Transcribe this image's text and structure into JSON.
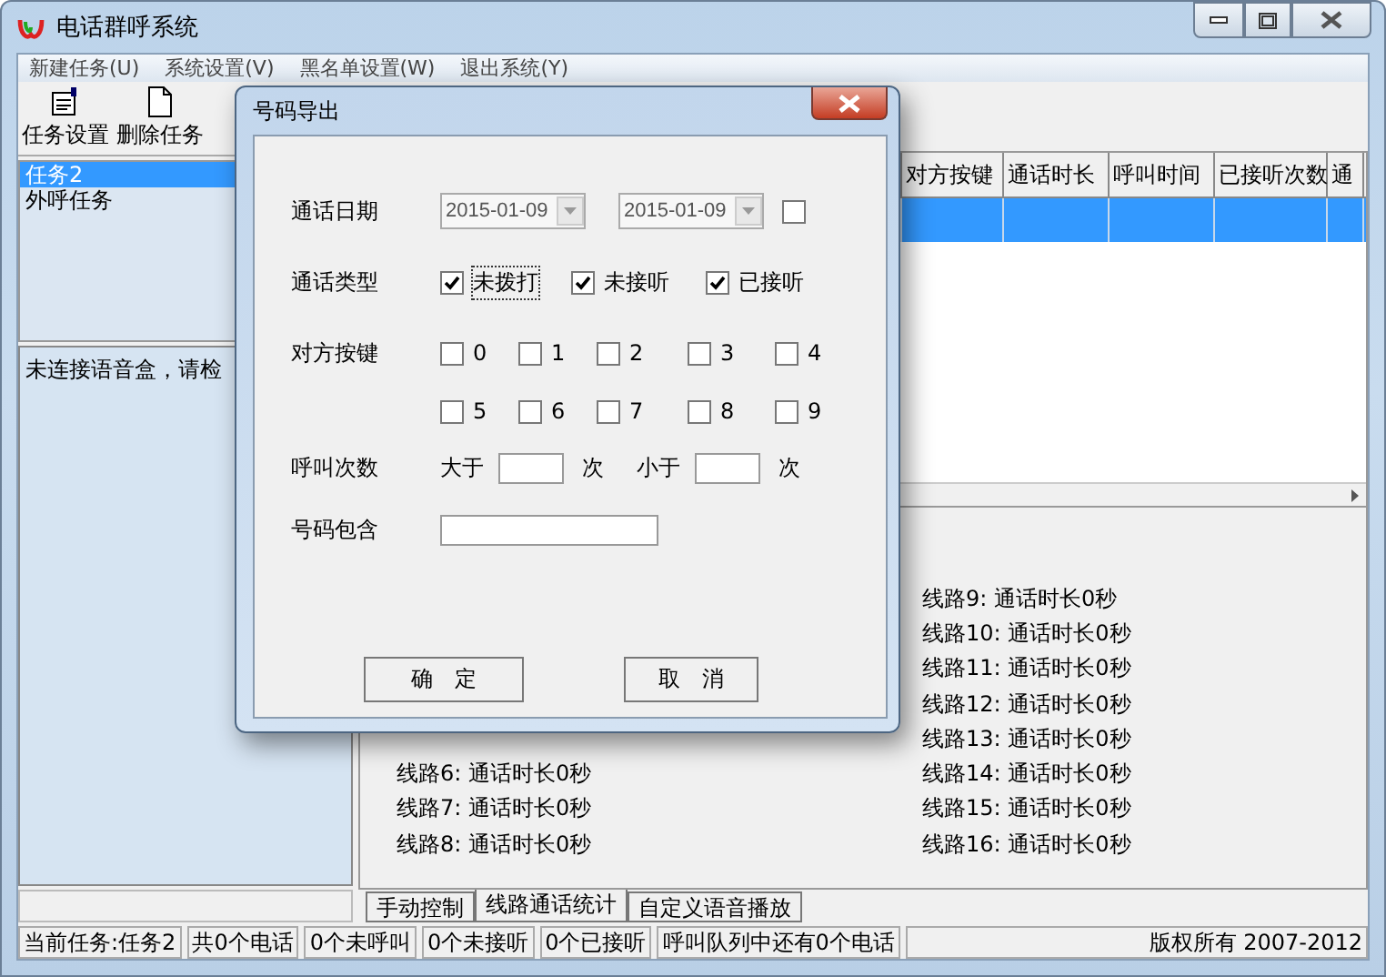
{
  "window": {
    "title": "电话群呼系统"
  },
  "menu": [
    "新建任务(U)",
    "系统设置(V)",
    "黑名单设置(W)",
    "退出系统(Y)"
  ],
  "toolbar": [
    {
      "label": "任务设置",
      "kind": "settings"
    },
    {
      "label": "删除任务",
      "kind": "document"
    }
  ],
  "tasks": [
    {
      "label": "任务2",
      "selected": true
    },
    {
      "label": "外呼任务",
      "selected": false
    }
  ],
  "message": "未连接语音盒，请检",
  "table": {
    "columns": [
      "对方按键",
      "通话时长",
      "呼叫时间",
      "已接听次数",
      "通"
    ],
    "rows": [
      {
        "selected": true
      }
    ]
  },
  "lines_left": [
    "线路6: 通话时长0秒",
    "线路7: 通话时长0秒",
    "线路8: 通话时长0秒"
  ],
  "lines_right": [
    "线路9: 通话时长0秒",
    "线路10: 通话时长0秒",
    "线路11: 通话时长0秒",
    "线路12: 通话时长0秒",
    "线路13: 通话时长0秒",
    "线路14: 通话时长0秒",
    "线路15: 通话时长0秒",
    "线路16: 通话时长0秒"
  ],
  "tabs": [
    {
      "label": "手动控制",
      "selected": false
    },
    {
      "label": "线路通话统计",
      "selected": true
    },
    {
      "label": "自定义语音播放",
      "selected": false
    }
  ],
  "status_bar": [
    "当前任务:任务2",
    "共0个电话",
    "0个未呼叫",
    "0个未接听",
    "0个已接听",
    "呼叫队列中还有0个电话",
    "版权所有 2007-2012"
  ],
  "dialog": {
    "title": "号码导出",
    "date_label": "通话日期",
    "date_from": "2015-01-09",
    "date_to": "2015-01-09",
    "date_enabled": false,
    "type_label": "通话类型",
    "types": [
      {
        "label": "未拨打",
        "checked": true,
        "focused": true
      },
      {
        "label": "未接听",
        "checked": true,
        "focused": false
      },
      {
        "label": "已接听",
        "checked": true,
        "focused": false
      }
    ],
    "keys_label": "对方按键",
    "keys": [
      {
        "label": "0",
        "checked": false
      },
      {
        "label": "1",
        "checked": false
      },
      {
        "label": "2",
        "checked": false
      },
      {
        "label": "3",
        "checked": false
      },
      {
        "label": "4",
        "checked": false
      },
      {
        "label": "5",
        "checked": false
      },
      {
        "label": "6",
        "checked": false
      },
      {
        "label": "7",
        "checked": false
      },
      {
        "label": "8",
        "checked": false
      },
      {
        "label": "9",
        "checked": false
      }
    ],
    "count_label": "呼叫次数",
    "more_label": "大于",
    "more_unit": "次",
    "less_label": "小于",
    "less_unit": "次",
    "contains_label": "号码包含",
    "ok": "确　定",
    "cancel": "取　消"
  }
}
